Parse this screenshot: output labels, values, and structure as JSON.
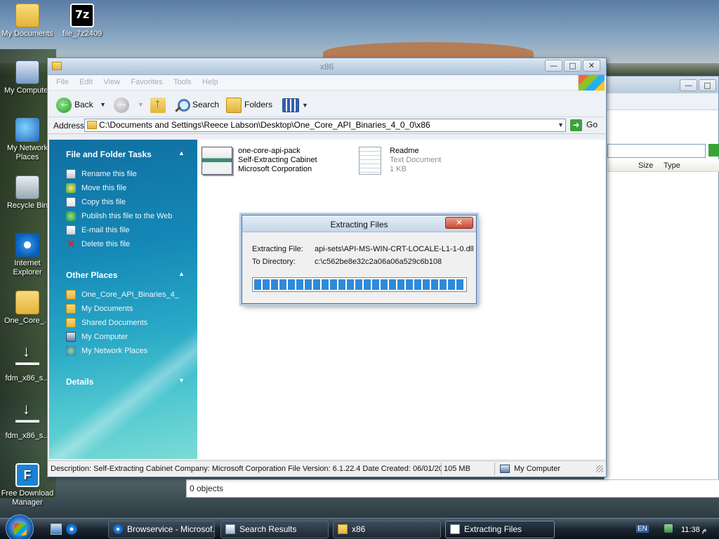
{
  "desktop": {
    "icons": [
      {
        "label": "My Documents",
        "icon": "folder-icon"
      },
      {
        "label": "file_7z2409",
        "icon": "7zip-icon"
      },
      {
        "label": "My Computer",
        "icon": "computer-icon"
      },
      {
        "label": "My Network Places",
        "icon": "network-icon"
      },
      {
        "label": "Recycle Bin",
        "icon": "recycle-bin-icon"
      },
      {
        "label": "Internet Explorer",
        "icon": "ie-icon"
      },
      {
        "label": "One_Core_...",
        "icon": "folder-icon"
      },
      {
        "label": "fdm_x86_s...",
        "icon": "download-icon"
      },
      {
        "label": "fdm_x86_s...",
        "icon": "download-icon"
      },
      {
        "label": "Free Download Manager",
        "icon": "fdm-icon"
      }
    ],
    "zip_glyph": "7z",
    "fdm_glyph": "F"
  },
  "background_window": {
    "columns": [
      "Size",
      "Type"
    ],
    "status": "0 objects"
  },
  "explorer": {
    "title": "x86",
    "window_buttons": {
      "minimize": "—",
      "maximize": "□",
      "close": "✕"
    },
    "menu": [
      "File",
      "Edit",
      "View",
      "Favorites",
      "Tools",
      "Help"
    ],
    "toolbar": {
      "back": "Back",
      "search": "Search",
      "folders": "Folders"
    },
    "address": {
      "label": "Address",
      "value": "C:\\Documents and Settings\\Reece Labson\\Desktop\\One_Core_API_Binaries_4_0_0\\x86",
      "go": "Go"
    },
    "tasks": {
      "file_section": "File and Folder Tasks",
      "file_items": [
        {
          "label": "Rename this file",
          "icon": "rename-icon"
        },
        {
          "label": "Move this file",
          "icon": "move-icon"
        },
        {
          "label": "Copy this file",
          "icon": "copy-icon"
        },
        {
          "label": "Publish this file to the Web",
          "icon": "publish-web-icon"
        },
        {
          "label": "E-mail this file",
          "icon": "email-icon"
        },
        {
          "label": "Delete this file",
          "icon": "delete-icon"
        }
      ],
      "other_section": "Other Places",
      "other_items": [
        {
          "label": "One_Core_API_Binaries_4_",
          "icon": "folder-icon"
        },
        {
          "label": "My Documents",
          "icon": "folder-icon"
        },
        {
          "label": "Shared Documents",
          "icon": "folder-icon"
        },
        {
          "label": "My Computer",
          "icon": "computer-icon"
        },
        {
          "label": "My Network Places",
          "icon": "network-icon"
        }
      ],
      "details_section": "Details",
      "chevron_up": "▲",
      "chevron_down": "▼"
    },
    "files": [
      {
        "name": "one-core-api-pack",
        "line2": "Self-Extracting Cabinet",
        "line3": "Microsoft Corporation",
        "icon": "cabinet-icon"
      },
      {
        "name": "Readme",
        "line2": "Text Document",
        "line3": "1 KB",
        "icon": "text-document-icon"
      }
    ],
    "status": {
      "description": "Description: Self-Extracting Cabinet Company: Microsoft Corporation File Version: 6.1.22.4 Date Created: 06/01/20",
      "size": "105 MB",
      "zone": "My Computer"
    }
  },
  "dialog": {
    "title": "Extracting Files",
    "close": "✕",
    "file_label": "Extracting File:",
    "file_value": "api-sets\\API-MS-WIN-CRT-LOCALE-L1-1-0.dll",
    "dir_label": "To Directory:",
    "dir_value": "c:\\c562be8e32c2a06a06a529c6b108",
    "progress": 1.0
  },
  "taskbar": {
    "tasks": [
      {
        "label": "Browservice - Microsof...",
        "icon": "ie-icon"
      },
      {
        "label": "Search Results",
        "icon": "search-results-icon"
      },
      {
        "label": "x86",
        "icon": "folder-icon"
      },
      {
        "label": "Extracting Files",
        "icon": "dialog-icon",
        "active": true
      }
    ],
    "language": "EN",
    "clock": "11:38 م"
  }
}
